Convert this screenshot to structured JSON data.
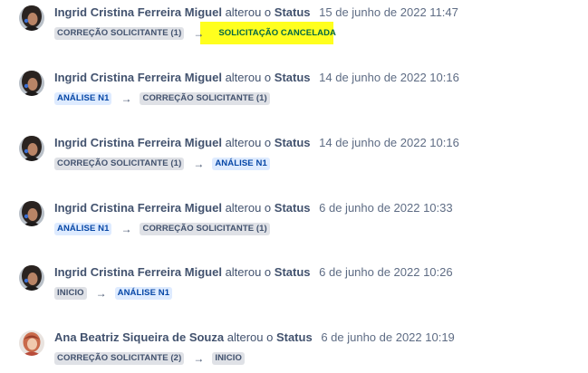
{
  "history": [
    {
      "author": "Ingrid Cristina Ferreira Miguel",
      "verb": "alterou o",
      "field": "Status",
      "date": "15 de junho de 2022 11:47",
      "avatar": "woman-dark-hair-avatar",
      "from": {
        "label": "CORREÇÃO SOLICITANTE (1)",
        "color": "#dfe1e6"
      },
      "to": {
        "label": "SOLICITAÇÃO CANCELADA",
        "color": "#ffff1e"
      },
      "arrow": "→"
    },
    {
      "author": "Ingrid Cristina Ferreira Miguel",
      "verb": "alterou o",
      "field": "Status",
      "date": "14 de junho de 2022 10:16",
      "avatar": "woman-dark-hair-avatar",
      "from": {
        "label": "ANÁLISE N1",
        "color": "#deebff"
      },
      "to": {
        "label": "CORREÇÃO SOLICITANTE (1)",
        "color": "#dfe1e6"
      },
      "arrow": "→"
    },
    {
      "author": "Ingrid Cristina Ferreira Miguel",
      "verb": "alterou o",
      "field": "Status",
      "date": "14 de junho de 2022 10:16",
      "avatar": "woman-dark-hair-avatar",
      "from": {
        "label": "CORREÇÃO SOLICITANTE (1)",
        "color": "#dfe1e6"
      },
      "to": {
        "label": "ANÁLISE N1",
        "color": "#deebff"
      },
      "arrow": "→"
    },
    {
      "author": "Ingrid Cristina Ferreira Miguel",
      "verb": "alterou o",
      "field": "Status",
      "date": "6 de junho de 2022 10:33",
      "avatar": "woman-dark-hair-avatar",
      "from": {
        "label": "ANÁLISE N1",
        "color": "#deebff"
      },
      "to": {
        "label": "CORREÇÃO SOLICITANTE (1)",
        "color": "#dfe1e6"
      },
      "arrow": "→"
    },
    {
      "author": "Ingrid Cristina Ferreira Miguel",
      "verb": "alterou o",
      "field": "Status",
      "date": "6 de junho de 2022 10:26",
      "avatar": "woman-dark-hair-avatar",
      "from": {
        "label": "INICIO",
        "color": "#dfe1e6"
      },
      "to": {
        "label": "ANÁLISE N1",
        "color": "#deebff"
      },
      "arrow": "→"
    },
    {
      "author": "Ana Beatriz Siqueira de Souza",
      "verb": "alterou o",
      "field": "Status",
      "date": "6 de junho de 2022 10:19",
      "avatar": "woman-light-avatar",
      "from": {
        "label": "CORREÇÃO SOLICITANTE (2)",
        "color": "#dfe1e6"
      },
      "to": {
        "label": "INICIO",
        "color": "#dfe1e6"
      },
      "arrow": "→"
    }
  ]
}
